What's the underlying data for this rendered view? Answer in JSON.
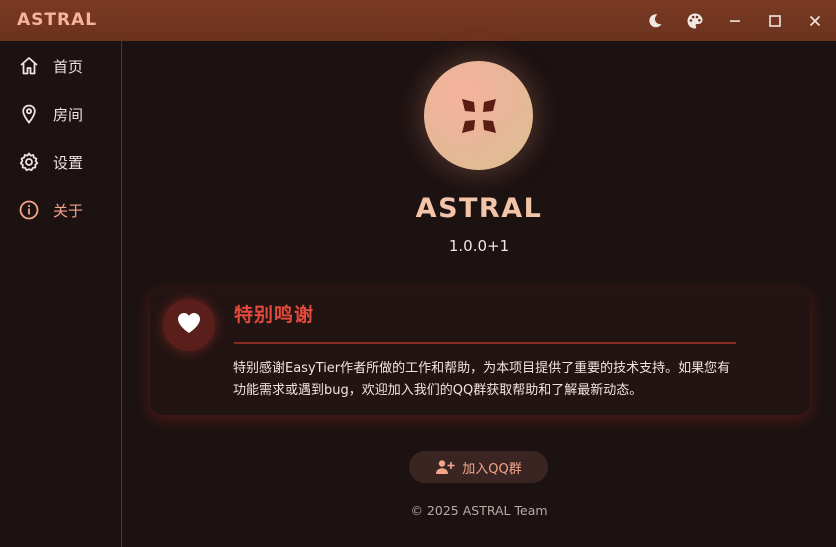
{
  "window": {
    "title": "ASTRAL",
    "controls": {
      "theme_mode_icon": "moon-icon",
      "palette_icon": "palette-icon",
      "minimize_icon": "minimize-icon",
      "maximize_icon": "maximize-icon",
      "close_icon": "close-icon"
    }
  },
  "sidebar": {
    "items": [
      {
        "label": "首页",
        "icon": "home-icon",
        "active": false
      },
      {
        "label": "房间",
        "icon": "location-pin-icon",
        "active": false
      },
      {
        "label": "设置",
        "icon": "gear-icon",
        "active": false
      },
      {
        "label": "关于",
        "icon": "info-icon",
        "active": true
      }
    ]
  },
  "about": {
    "logo_icon": "astral-logo-icon",
    "app_name": "ASTRAL",
    "version": "1.0.0+1",
    "thanks_card": {
      "icon": "heart-icon",
      "title": "特别鸣谢",
      "body_line1": "特别感谢EasyTier作者所做的工作和帮助，为本项目提供了重要的技术支持。如果您有",
      "body_line2": "功能需求或遇到bug，欢迎加入我们的QQ群获取帮助和了解最新动态。"
    },
    "join_button": {
      "icon": "group-add-icon",
      "label": "加入QQ群"
    },
    "copyright": "© 2025 ASTRAL Team"
  },
  "colors": {
    "titlebar": "#7a3a22",
    "accent": "#f6a48c",
    "card_title": "#e24a3c",
    "background": "#1c1212"
  }
}
